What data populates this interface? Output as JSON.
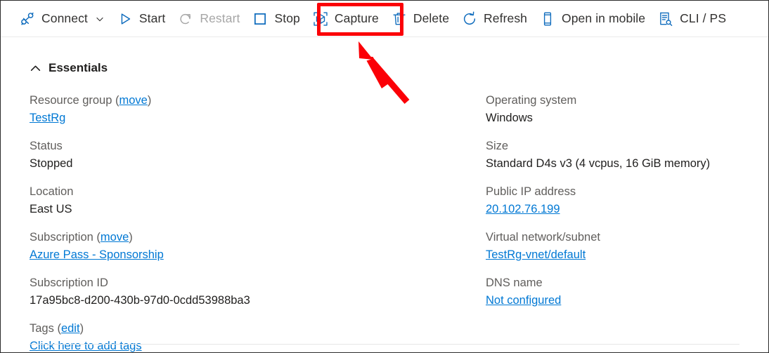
{
  "toolbar": {
    "items": [
      {
        "label": "Connect",
        "icon": "plug-icon",
        "disabled": false,
        "has_chevron": true
      },
      {
        "label": "Start",
        "icon": "play-icon",
        "disabled": false,
        "has_chevron": false
      },
      {
        "label": "Restart",
        "icon": "restart-icon",
        "disabled": true,
        "has_chevron": false
      },
      {
        "label": "Stop",
        "icon": "stop-square-icon",
        "disabled": false,
        "has_chevron": false
      },
      {
        "label": "Capture",
        "icon": "capture-cube-icon",
        "disabled": false,
        "has_chevron": false
      },
      {
        "label": "Delete",
        "icon": "trash-icon",
        "disabled": false,
        "has_chevron": false
      },
      {
        "label": "Refresh",
        "icon": "refresh-icon",
        "disabled": false,
        "has_chevron": false
      },
      {
        "label": "Open in mobile",
        "icon": "mobile-phone-icon",
        "disabled": false,
        "has_chevron": false
      },
      {
        "label": "CLI / PS",
        "icon": "cli-console-icon",
        "disabled": false,
        "has_chevron": false
      }
    ]
  },
  "essentials": {
    "title": "Essentials",
    "collapse_icon": "chevron-up-icon",
    "left": {
      "resource_group": {
        "label": "Resource group",
        "label_action": "move",
        "value": "TestRg"
      },
      "status": {
        "label": "Status",
        "value": "Stopped"
      },
      "location": {
        "label": "Location",
        "value": "East US"
      },
      "subscription": {
        "label": "Subscription",
        "label_action": "move",
        "value": "Azure Pass - Sponsorship"
      },
      "subscription_id": {
        "label": "Subscription ID",
        "value": "17a95bc8-d200-430b-97d0-0cdd53988ba3"
      },
      "tags": {
        "label": "Tags",
        "label_action": "edit",
        "value": "Click here to add tags"
      }
    },
    "right": {
      "operating_system": {
        "label": "Operating system",
        "value": "Windows"
      },
      "size": {
        "label": "Size",
        "value": "Standard D4s v3 (4 vcpus, 16 GiB memory)"
      },
      "public_ip": {
        "label": "Public IP address",
        "value": "20.102.76.199"
      },
      "virtual_network": {
        "label": "Virtual network/subnet",
        "value": "TestRg-vnet/default"
      },
      "dns_name": {
        "label": "DNS name",
        "value": "Not configured"
      }
    }
  },
  "annotations": {
    "highlight_target": "Capture",
    "highlight_color": "#fb0007",
    "arrow_color": "#fb0007",
    "arrow_points_to": "capture-button"
  },
  "colors": {
    "accent_blue": "#0078d4",
    "label_grey": "#605e5c",
    "value_dark": "#201f1e",
    "disabled_grey": "#a6a6a6",
    "annotation_red": "#fb0007"
  }
}
